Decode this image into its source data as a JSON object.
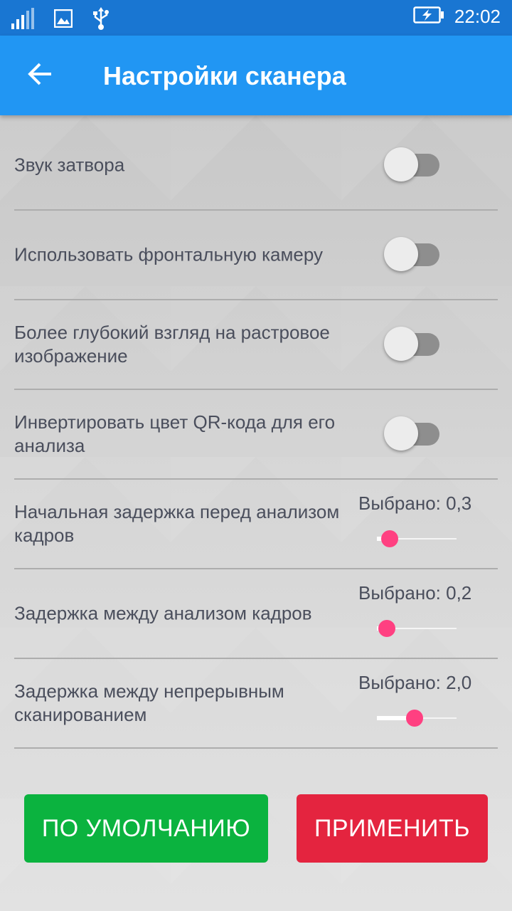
{
  "status_bar": {
    "time": "22:02",
    "icons": [
      "signal-icon",
      "image-icon",
      "usb-icon",
      "battery-charging-icon"
    ]
  },
  "app_bar": {
    "title": "Настройки сканера",
    "back_icon": "arrow-back-icon"
  },
  "settings": [
    {
      "type": "toggle",
      "label": "Звук затвора",
      "on": false
    },
    {
      "type": "toggle",
      "label": "Использовать фронтальную камеру",
      "on": false
    },
    {
      "type": "toggle",
      "label": "Более глубокий взгляд на растровое изображение",
      "on": false
    },
    {
      "type": "toggle",
      "label": "Инвертировать цвет QR-кода для его анализа",
      "on": false
    },
    {
      "type": "slider",
      "label": "Начальная задержка перед анализом кадров",
      "value_text": "Выбрано: 0,3",
      "position": 0.05
    },
    {
      "type": "slider",
      "label": "Задержка между анализом кадров",
      "value_text": "Выбрано: 0,2",
      "position": 0.02
    },
    {
      "type": "slider",
      "label": "Задержка между непрерывным сканированием",
      "value_text": "Выбрано: 2,0",
      "position": 0.37
    }
  ],
  "buttons": {
    "default_label": "ПО УМОЛЧАНИЮ",
    "apply_label": "ПРИМЕНИТЬ"
  },
  "colors": {
    "status_bar": "#1976d2",
    "app_bar": "#2196f3",
    "accent": "#ff4081",
    "default_button": "#0bb33f",
    "apply_button": "#e4243f"
  }
}
